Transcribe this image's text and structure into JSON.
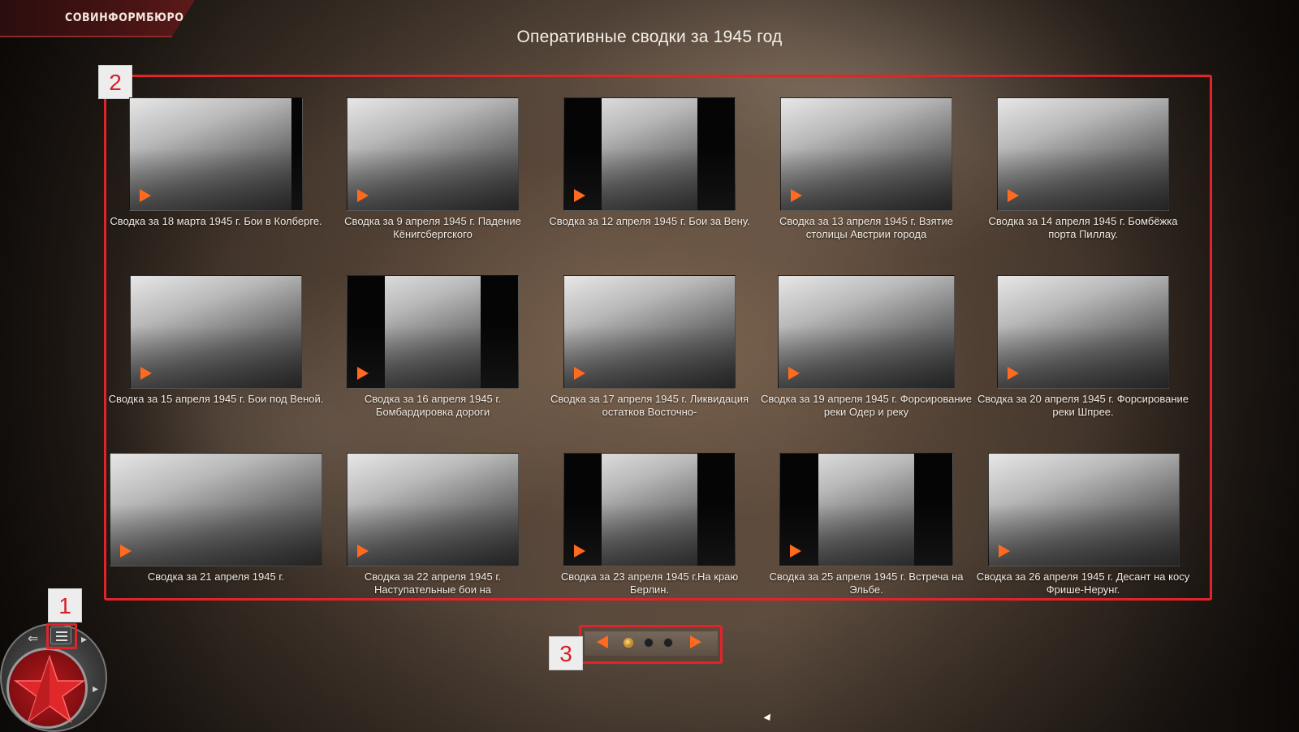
{
  "app": {
    "logo_text": "СОВИНФОРМБЮРО",
    "page_title": "Оперативные сводки за 1945 год"
  },
  "colors": {
    "accent_red": "#e0242a",
    "play_orange": "#ff6a1e",
    "logo_bg": "#4a1414"
  },
  "callouts": {
    "nav": "1",
    "grid": "2",
    "pager": "3"
  },
  "videos": [
    {
      "caption": "Сводка за 18 марта 1945 г. Бои в Колберге."
    },
    {
      "caption": "Сводка за 9 апреля 1945 г. Падение Кёнигсбергского"
    },
    {
      "caption": "Сводка за 12 апреля 1945 г. Бои за Вену."
    },
    {
      "caption": "Сводка за 13 апреля 1945 г. Взятие столицы Австрии города"
    },
    {
      "caption": "Сводка за 14 апреля 1945 г. Бомбёжка порта Пиллау."
    },
    {
      "caption": "Сводка за 15 апреля 1945 г. Бои под Веной."
    },
    {
      "caption": "Сводка за 16 апреля 1945 г. Бомбардировка дороги"
    },
    {
      "caption": "Сводка за 17 апреля 1945 г. Ликвидация остатков Восточно-"
    },
    {
      "caption": "Сводка за 19 апреля 1945 г. Форсирование реки Одер и реку"
    },
    {
      "caption": "Сводка за 20 апреля 1945 г. Форсирование реки Шпрее."
    },
    {
      "caption": "Сводка за 21 апреля 1945 г."
    },
    {
      "caption": "Сводка за 22 апреля 1945 г. Наступательные бои на"
    },
    {
      "caption": "Сводка за 23 апреля 1945 г.На краю Берлин."
    },
    {
      "caption": "Сводка за 25 апреля 1945 г. Встреча на Эльбе."
    },
    {
      "caption": "Сводка за 26 апреля 1945 г. Десант на косу Фрише-Нерунг."
    }
  ],
  "pager": {
    "pages": 3,
    "current": 1,
    "prev_icon": "arrow-left-icon",
    "next_icon": "arrow-right-icon"
  },
  "nav_wheel": {
    "center_icon": "red-star-icon",
    "menu_icon": "menu-icon",
    "back_icon": "back-arrow-icon"
  }
}
